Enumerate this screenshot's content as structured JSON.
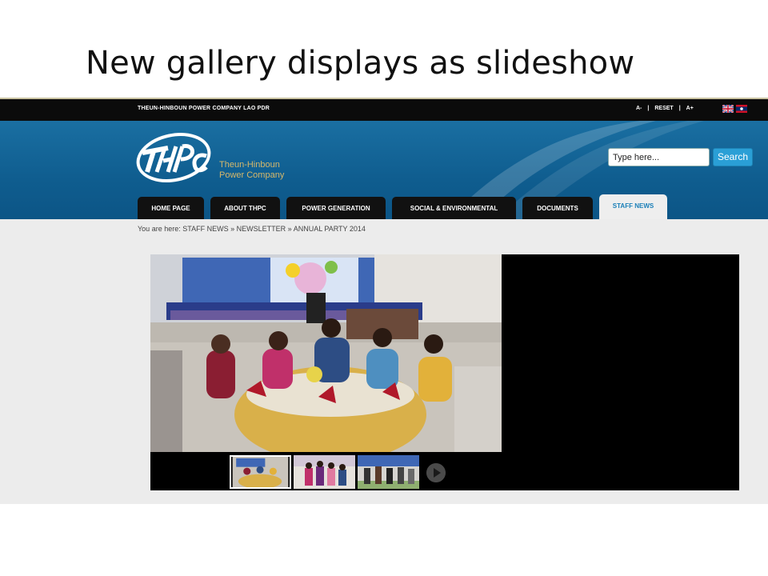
{
  "slide": {
    "title": "New gallery displays as slideshow"
  },
  "topbar": {
    "company_name": "THEUN-HINBOUN POWER COMPANY LAO PDR",
    "font_decrease": "A-",
    "separator": "|",
    "font_reset": "RESET",
    "font_increase": "A+",
    "languages": [
      "english-flag-icon",
      "lao-flag-icon"
    ]
  },
  "header": {
    "logo_text_line1": "Theun-Hinboun",
    "logo_text_line2": "Power Company",
    "search": {
      "placeholder": "Type here...",
      "value": "Type here...",
      "button_label": "Search"
    }
  },
  "nav": {
    "tabs": [
      {
        "label": "HOME PAGE",
        "active": false
      },
      {
        "label": "ABOUT THPC",
        "active": false
      },
      {
        "label": "POWER GENERATION",
        "active": false
      },
      {
        "label": "SOCIAL & ENVIRONMENTAL",
        "active": false
      },
      {
        "label": "DOCUMENTS",
        "active": false
      },
      {
        "label": "STAFF NEWS",
        "active": true
      }
    ]
  },
  "breadcrumb": {
    "prefix": "You are here:",
    "items": [
      "STAFF NEWS",
      "NEWSLETTER",
      "ANNUAL PARTY 2014"
    ],
    "separator": "»"
  },
  "gallery": {
    "thumbnail_count": 3,
    "selected_index": 0,
    "play_icon": "play-icon"
  },
  "colors": {
    "header_blue": "#0f5d8f",
    "search_button": "#2a9fd6",
    "active_tab_text": "#1a7fb8",
    "topbar": "#0b0b0b"
  }
}
